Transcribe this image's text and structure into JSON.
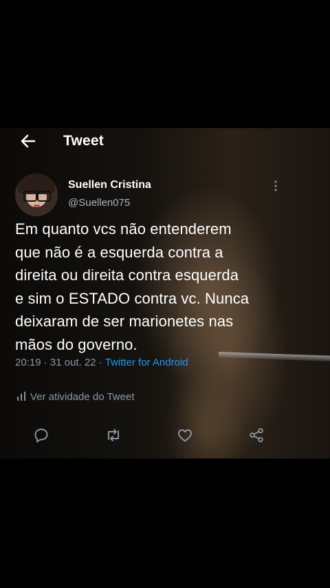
{
  "header": {
    "title": "Tweet"
  },
  "tweet": {
    "author_name": "Suellen Cristina",
    "author_handle": "@Suellen075",
    "text": "Em quanto vcs não entenderem\nque não é a esquerda contra a\ndireita ou direita contra esquerda\ne sim o ESTADO contra vc. Nunca\ndeixaram de ser marionetes nas\nmãos do governo.",
    "time": "20:19",
    "date": "31 out. 22",
    "separator": "·",
    "source": "Twitter for Android"
  },
  "activity": {
    "label": "Ver atividade do Tweet"
  },
  "actions": [
    "reply-icon",
    "retweet-icon",
    "like-icon",
    "share-icon"
  ],
  "colors": {
    "link": "#1d9bf0",
    "muted": "#8b98a5",
    "text": "#ffffff"
  }
}
